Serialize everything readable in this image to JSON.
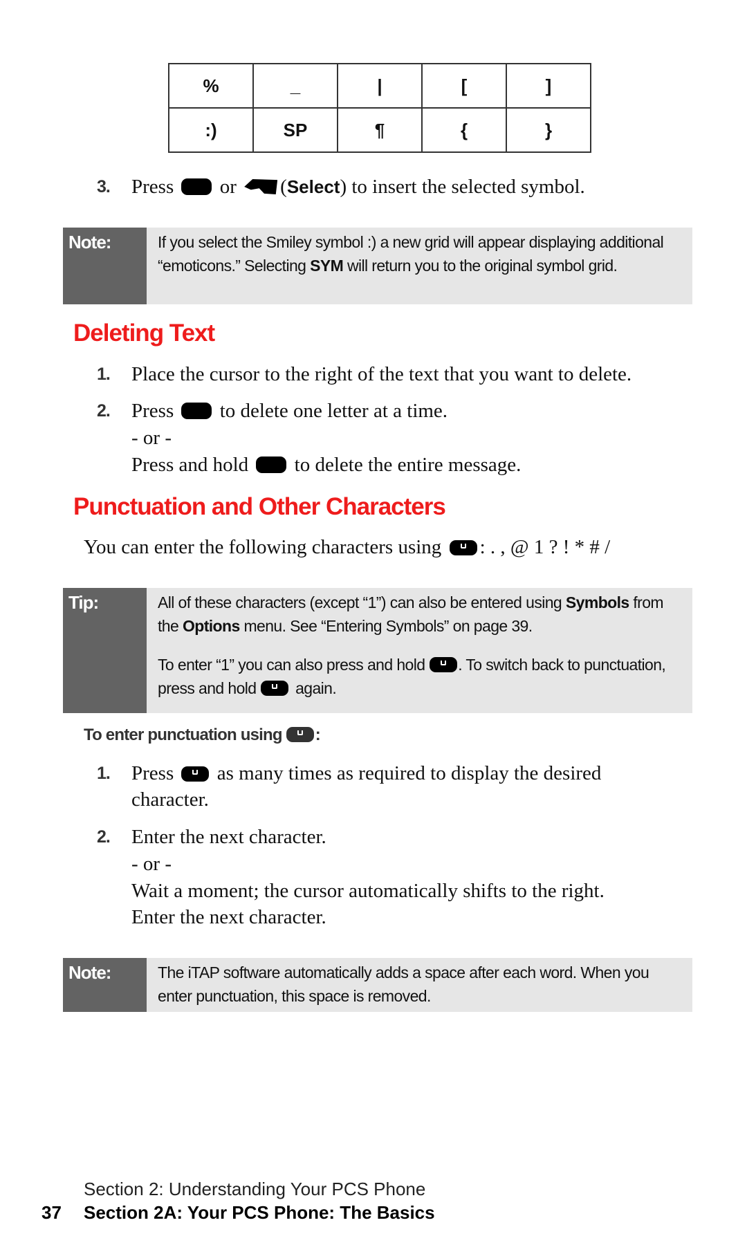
{
  "symbol_grid": {
    "rows": [
      [
        "%",
        "_",
        "|",
        "[",
        "]"
      ],
      [
        ":)",
        "SP",
        "¶",
        "{",
        "}"
      ]
    ]
  },
  "select_step": {
    "number": "3.",
    "before": "Press",
    "or": "or",
    "select_label": "Select",
    "after": ") to insert the selected symbol.",
    "open_paren": "("
  },
  "note1": {
    "label": "Note:",
    "text_a": "If you select the Smiley symbol :) a new grid will appear displaying additional “emoticons.” Selecting ",
    "bold": "SYM",
    "text_b": " will return you to the original symbol grid."
  },
  "deleting": {
    "heading": "Deleting Text",
    "steps": [
      {
        "number": "1.",
        "text": "Place the cursor to the right of the text that you want to delete."
      },
      {
        "number": "2.",
        "before": "Press",
        "after": "to delete one letter at a time."
      }
    ],
    "or": "- or -",
    "hold_before": "Press and hold",
    "hold_after": "to delete the entire message."
  },
  "punctuation": {
    "heading": "Punctuation and Other Characters",
    "intro_before": "You can enter the following characters using",
    "intro_after": ": . , @ 1 ? ! * # /",
    "tip": {
      "label": "Tip:",
      "p1_a": "All of these characters (except “1”) can also be entered using ",
      "p1_b1": "Symbols",
      "p1_c": " from the ",
      "p1_b2": "Options",
      "p1_d": " menu. See “Entering Symbols” on page 39.",
      "p2_a": "To enter “1” you can also press and hold ",
      "p2_b": ". To switch back to punctuation, press and hold ",
      "p2_c": " again."
    },
    "subheading_before": "To enter punctuation using",
    "subheading_after": ":",
    "steps": [
      {
        "number": "1.",
        "before": "Press",
        "after": "as many times as required to display the desired",
        "cont": "character."
      },
      {
        "number": "2.",
        "text": "Enter the next character."
      }
    ],
    "or": "- or -",
    "wait": "Wait a moment; the cursor automatically shifts to the right.",
    "enter_next": "Enter the next character."
  },
  "note2": {
    "label": "Note:",
    "text": "The iTAP software automatically adds a space after each word. When you enter punctuation, this space is removed."
  },
  "footer": {
    "section": "Section 2: Understanding Your PCS Phone",
    "page_number": "37",
    "chapter": "Section 2A: Your PCS Phone: The Basics"
  },
  "colors": {
    "heading": "#ee1c1c",
    "callout_label_bg": "#636363",
    "callout_body_bg": "#e6e6e6"
  }
}
